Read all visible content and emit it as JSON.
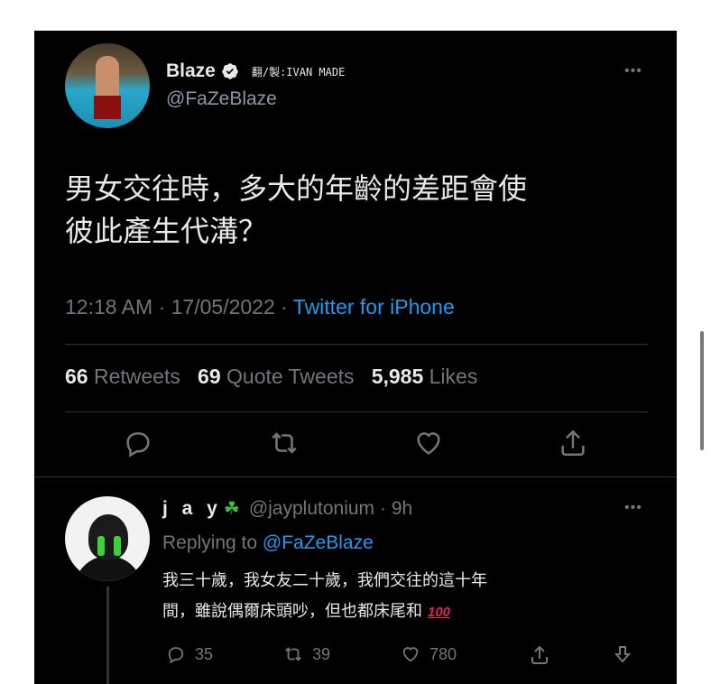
{
  "tweet": {
    "author_name": "Blaze",
    "watermark": "翻/製:IVAN MADE",
    "author_handle": "@FaZeBlaze",
    "text_line1": "男女交往時，多大的年齡的差距會使",
    "text_line2": "彼此產生代溝？",
    "time": "12:18 AM",
    "date": "17/05/2022",
    "source": "Twitter for iPhone",
    "retweets_count": "66",
    "retweets_label": "Retweets",
    "quotes_count": "69",
    "quotes_label": "Quote Tweets",
    "likes_count": "5,985",
    "likes_label": "Likes",
    "more": "•••"
  },
  "reply": {
    "name": "j a y",
    "clover": "☘",
    "handle": "@jayplutonium",
    "time": "· 9h",
    "replying_prefix": "Replying to",
    "replying_to": "@FaZeBlaze",
    "text_line1": "我三十歲，我女友二十歲，我們交往的這十年",
    "text_line2": "間，雖說偶爾床頭吵，但也都床尾和",
    "emoji": "100",
    "reply_count": "35",
    "retweet_count": "39",
    "like_count": "780",
    "more": "•••"
  },
  "colors": {
    "background": "#000000",
    "text": "#e7e9ea",
    "muted": "#71767b",
    "accent": "#1d9bf0"
  },
  "icons": [
    "verified-badge-icon",
    "reply-icon",
    "retweet-icon",
    "like-icon",
    "share-icon",
    "more-icon",
    "clover-icon",
    "download-icon"
  ]
}
